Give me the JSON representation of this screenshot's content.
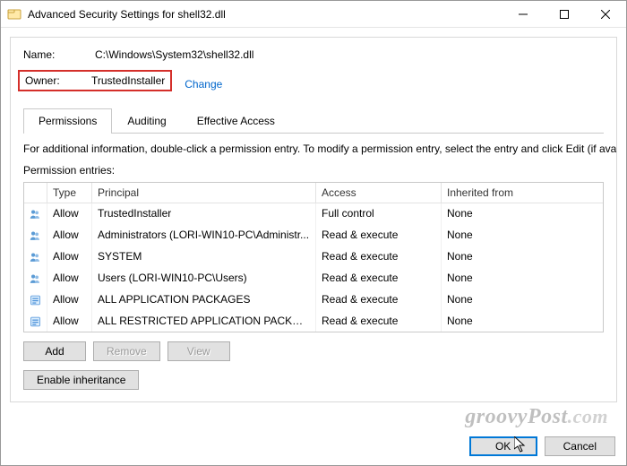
{
  "window": {
    "title": "Advanced Security Settings for shell32.dll"
  },
  "name_row": {
    "label": "Name:",
    "value": "C:\\Windows\\System32\\shell32.dll"
  },
  "owner_row": {
    "label": "Owner:",
    "value": "TrustedInstaller",
    "change": "Change"
  },
  "tabs": {
    "permissions": "Permissions",
    "auditing": "Auditing",
    "effective_access": "Effective Access"
  },
  "info_text": "For additional information, double-click a permission entry. To modify a permission entry, select the entry and click Edit (if availa",
  "subhead": "Permission entries:",
  "table": {
    "headers": {
      "type": "Type",
      "principal": "Principal",
      "access": "Access",
      "inherited": "Inherited from"
    },
    "rows": [
      {
        "icon": "users",
        "type": "Allow",
        "principal": "TrustedInstaller",
        "access": "Full control",
        "inherited": "None"
      },
      {
        "icon": "users",
        "type": "Allow",
        "principal": "Administrators (LORI-WIN10-PC\\Administr...",
        "access": "Read & execute",
        "inherited": "None"
      },
      {
        "icon": "users",
        "type": "Allow",
        "principal": "SYSTEM",
        "access": "Read & execute",
        "inherited": "None"
      },
      {
        "icon": "users",
        "type": "Allow",
        "principal": "Users (LORI-WIN10-PC\\Users)",
        "access": "Read & execute",
        "inherited": "None"
      },
      {
        "icon": "package",
        "type": "Allow",
        "principal": "ALL APPLICATION PACKAGES",
        "access": "Read & execute",
        "inherited": "None"
      },
      {
        "icon": "package",
        "type": "Allow",
        "principal": "ALL RESTRICTED APPLICATION PACKAGES",
        "access": "Read & execute",
        "inherited": "None"
      }
    ]
  },
  "buttons": {
    "add": "Add",
    "remove": "Remove",
    "view": "View",
    "enable_inheritance": "Enable inheritance",
    "ok": "OK",
    "cancel": "Cancel"
  },
  "watermark": "groovyPost",
  "watermark_suffix": ".com"
}
